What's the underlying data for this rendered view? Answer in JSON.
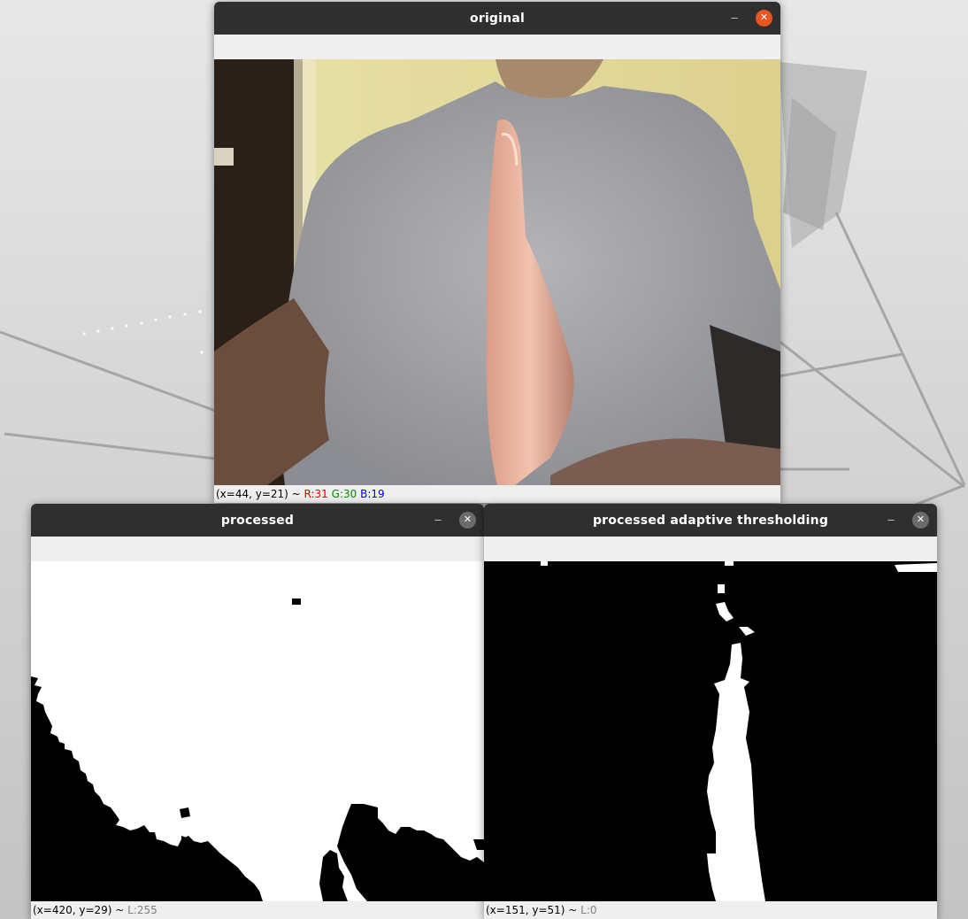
{
  "colors": {
    "titlebar": "#2f2f2f",
    "close_active": "#e95420",
    "close_inactive": "#6b6b6b",
    "channel_r": "#e00000",
    "channel_g": "#008a00",
    "channel_b": "#0000e0",
    "luma_text": "#808080"
  },
  "windows": {
    "original": {
      "title": "original",
      "minimize_icon": "minimize-icon",
      "close_icon": "close-icon",
      "status": {
        "coords": "(x=44, y=21) ~ ",
        "r": "R:31",
        "g": "G:30",
        "b": "B:19"
      }
    },
    "processed": {
      "title": "processed",
      "minimize_icon": "minimize-icon",
      "close_icon": "close-icon",
      "status": {
        "coords": "(x=420, y=29) ~ ",
        "l": "L:255"
      }
    },
    "adaptive": {
      "title": "processed adaptive thresholding",
      "minimize_icon": "minimize-icon",
      "close_icon": "close-icon",
      "status": {
        "coords": "(x=151, y=51) ~ ",
        "l": "L:0"
      }
    }
  }
}
